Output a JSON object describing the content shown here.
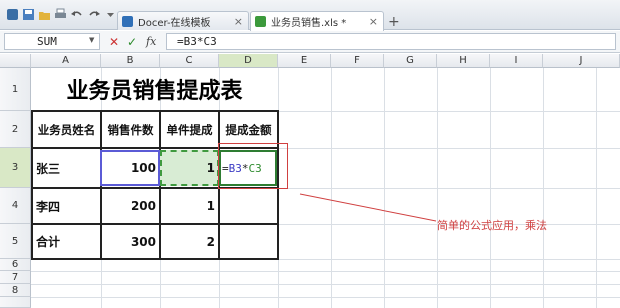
{
  "tabs": [
    {
      "icon": "docer-d-icon",
      "label": "Docer-在线模板",
      "close": "×"
    },
    {
      "icon": "spreadsheet-s-icon",
      "label": "业务员销售.xls *",
      "close": "×"
    }
  ],
  "new_tab": "+",
  "formula_bar": {
    "name_box": "SUM",
    "cancel": "✕",
    "enter": "✓",
    "fx": "fx",
    "formula": "=B3*C3"
  },
  "columns": [
    "A",
    "B",
    "C",
    "D",
    "E",
    "F",
    "G",
    "H",
    "I",
    "J"
  ],
  "rows": [
    "1",
    "2",
    "3",
    "4",
    "5",
    "6",
    "7",
    "8"
  ],
  "sheet": {
    "title": "业务员销售提成表",
    "headers": [
      "业务员姓名",
      "销售件数",
      "单件提成",
      "提成金额"
    ],
    "records": [
      {
        "name": "张三",
        "qty": "100",
        "commission": "1",
        "formula_ref1": "B3",
        "formula_ref2": "C3"
      },
      {
        "name": "李四",
        "qty": "200",
        "commission": "1"
      },
      {
        "name": "合计",
        "qty": "300",
        "commission": "2"
      }
    ],
    "formula_eq": "=",
    "formula_op": "*"
  },
  "annotation": "简单的公式应用，乘法",
  "colors": {
    "selection": "#5b5bd6",
    "copy_range": "#3f9a3f",
    "annotation": "#d04040",
    "header_selected": "#d9e8c6"
  }
}
